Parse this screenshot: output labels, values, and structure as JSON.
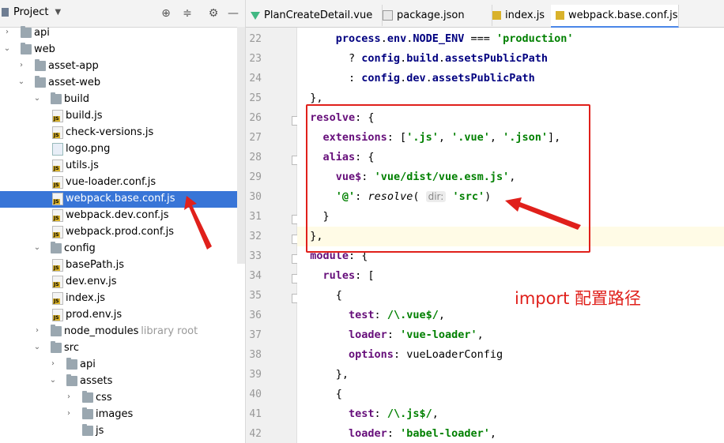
{
  "project_panel": {
    "title": "Project",
    "tree": [
      {
        "label": "api",
        "kind": "folder",
        "depth": 0,
        "expanded": false
      },
      {
        "label": "web",
        "kind": "folder",
        "depth": 0,
        "expanded": true
      },
      {
        "label": "asset-app",
        "kind": "folder",
        "depth": 1,
        "expanded": false
      },
      {
        "label": "asset-web",
        "kind": "folder",
        "depth": 1,
        "expanded": true
      },
      {
        "label": "build",
        "kind": "folder",
        "depth": 2,
        "expanded": true
      },
      {
        "label": "build.js",
        "kind": "js",
        "depth": 3
      },
      {
        "label": "check-versions.js",
        "kind": "js",
        "depth": 3
      },
      {
        "label": "logo.png",
        "kind": "png",
        "depth": 3
      },
      {
        "label": "utils.js",
        "kind": "js",
        "depth": 3
      },
      {
        "label": "vue-loader.conf.js",
        "kind": "js",
        "depth": 3
      },
      {
        "label": "webpack.base.conf.js",
        "kind": "js",
        "depth": 3,
        "selected": true
      },
      {
        "label": "webpack.dev.conf.js",
        "kind": "js",
        "depth": 3
      },
      {
        "label": "webpack.prod.conf.js",
        "kind": "js",
        "depth": 3
      },
      {
        "label": "config",
        "kind": "folder",
        "depth": 2,
        "expanded": true
      },
      {
        "label": "basePath.js",
        "kind": "js",
        "depth": 3
      },
      {
        "label": "dev.env.js",
        "kind": "js",
        "depth": 3
      },
      {
        "label": "index.js",
        "kind": "js",
        "depth": 3
      },
      {
        "label": "prod.env.js",
        "kind": "js",
        "depth": 3
      },
      {
        "label": "node_modules",
        "kind": "folder",
        "depth": 2,
        "expanded": false,
        "hint": "library root"
      },
      {
        "label": "src",
        "kind": "folder",
        "depth": 2,
        "expanded": true
      },
      {
        "label": "api",
        "kind": "folder",
        "depth": 3,
        "expanded": false
      },
      {
        "label": "assets",
        "kind": "folder",
        "depth": 3,
        "expanded": true
      },
      {
        "label": "css",
        "kind": "folder",
        "depth": 4,
        "expanded": false
      },
      {
        "label": "images",
        "kind": "folder",
        "depth": 4,
        "expanded": false
      },
      {
        "label": "js",
        "kind": "folder",
        "depth": 4,
        "expanded": null
      }
    ]
  },
  "tabs": [
    {
      "label": "PlanCreateDetail.vue",
      "icon": "vue-icon",
      "active": false
    },
    {
      "label": "package.json",
      "icon": "json-icon",
      "active": false
    },
    {
      "label": "index.js",
      "icon": "js-icon",
      "active": false
    },
    {
      "label": "webpack.base.conf.js",
      "icon": "js-icon",
      "active": true
    }
  ],
  "editor": {
    "highlight_line": 32,
    "lines": [
      {
        "n": "22",
        "text": "      process.env.NODE_ENV === 'production'"
      },
      {
        "n": "23",
        "text": "        ? config.build.assetsPublicPath"
      },
      {
        "n": "24",
        "text": "        : config.dev.assetsPublicPath"
      },
      {
        "n": "25",
        "text": "  },"
      },
      {
        "n": "26",
        "text": "  resolve: {"
      },
      {
        "n": "27",
        "text": "    extensions: ['.js', '.vue', '.json'],"
      },
      {
        "n": "28",
        "text": "    alias: {"
      },
      {
        "n": "29",
        "text": "      vue$: 'vue/dist/vue.esm.js',"
      },
      {
        "n": "30",
        "text": "      '@': resolve( dir: 'src')"
      },
      {
        "n": "31",
        "text": "    }"
      },
      {
        "n": "32",
        "text": "  },"
      },
      {
        "n": "33",
        "text": "  module: {"
      },
      {
        "n": "34",
        "text": "    rules: ["
      },
      {
        "n": "35",
        "text": "      {"
      },
      {
        "n": "36",
        "text": "        test: /\\.vue$/,"
      },
      {
        "n": "37",
        "text": "        loader: 'vue-loader',"
      },
      {
        "n": "38",
        "text": "        options: vueLoaderConfig"
      },
      {
        "n": "39",
        "text": "      },"
      },
      {
        "n": "40",
        "text": "      {"
      },
      {
        "n": "41",
        "text": "        test: /\\.js$/,"
      },
      {
        "n": "42",
        "text": "        loader: 'babel-loader',"
      }
    ]
  },
  "annotation": {
    "text": "import 配置路径",
    "color": "#e0201b"
  }
}
